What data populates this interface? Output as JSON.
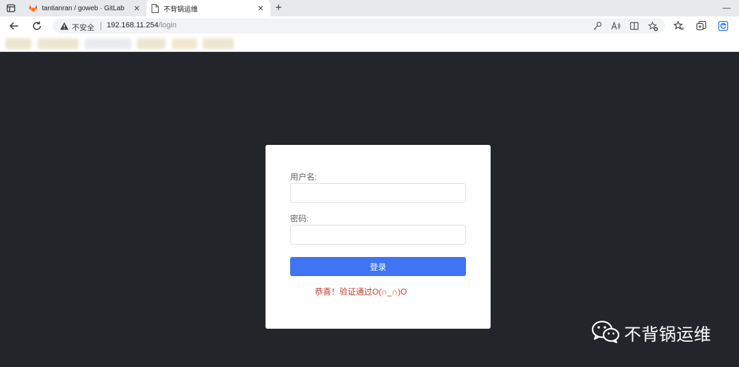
{
  "browser": {
    "tabs": [
      {
        "title": "tantianran / goweb · GitLab",
        "favicon": "gitlab-icon",
        "active": false
      },
      {
        "title": "不背锅运维",
        "favicon": "page-icon",
        "active": true
      }
    ],
    "address": {
      "security_label": "不安全",
      "url_host": "192.168.11.254",
      "url_path": "/login"
    },
    "icons": {
      "tab_actions": "tab-actions-icon",
      "new_tab": "plus-icon",
      "minimize": "minimize-icon",
      "back": "arrow-left-icon",
      "refresh": "refresh-icon",
      "warning": "warning-icon",
      "key": "key-icon",
      "read_aloud": "read-aloud-icon",
      "reader": "reader-icon",
      "favorite": "add-favorite-icon",
      "favorites": "favorites-icon",
      "collections": "collections-icon",
      "edge": "edge-icon"
    }
  },
  "login": {
    "username_label": "用户名:",
    "password_label": "密码:",
    "username_value": "",
    "password_value": "",
    "submit_label": "登录",
    "message": "恭喜！验证通过O(∩_∩)O"
  },
  "watermark": {
    "text": "不背锅运维",
    "icon": "wechat-icon"
  },
  "colors": {
    "page_bg": "#222529",
    "button": "#3f74f2",
    "message": "#c0392b"
  }
}
